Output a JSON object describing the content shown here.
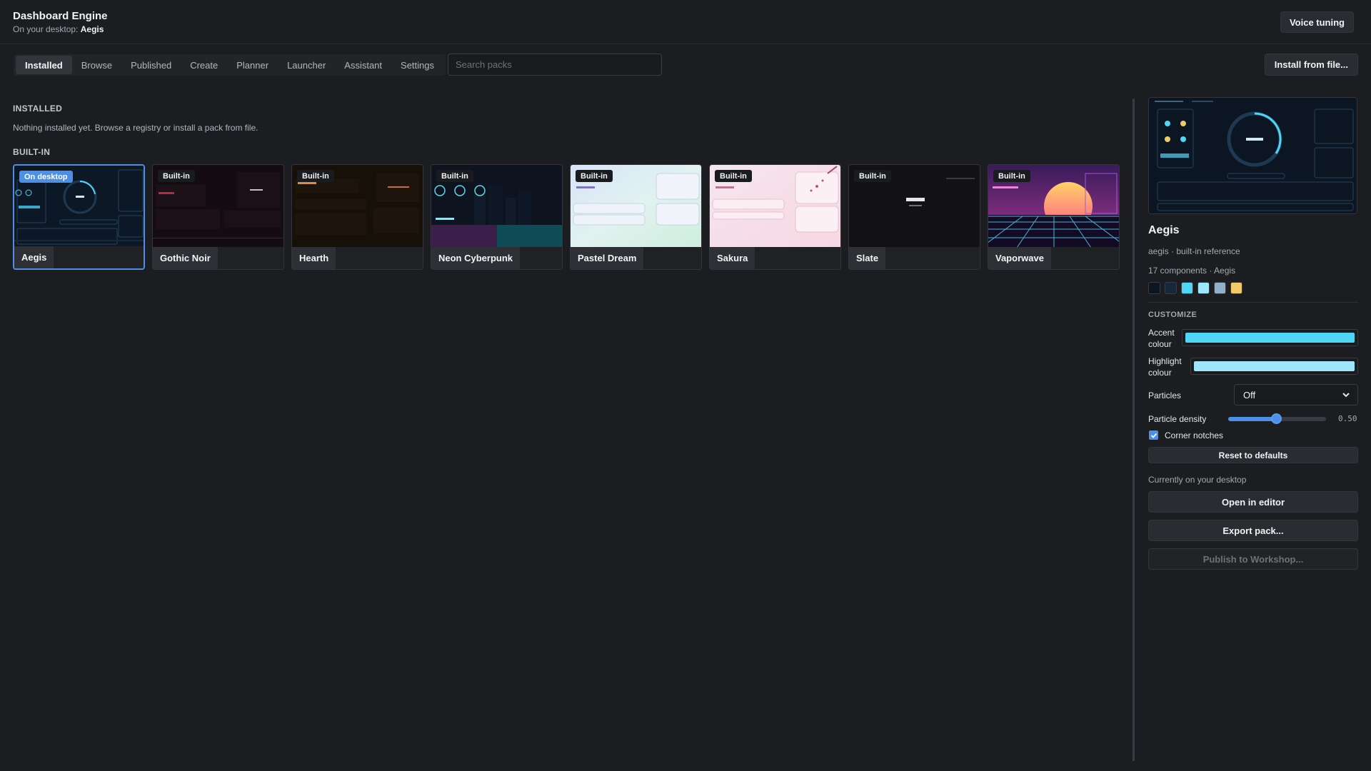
{
  "header": {
    "title": "Dashboard Engine",
    "subtitle_prefix": "On your desktop:",
    "subtitle_value": "Aegis",
    "voice_button": "Voice tuning"
  },
  "tabs": [
    {
      "label": "Installed",
      "active": true
    },
    {
      "label": "Browse"
    },
    {
      "label": "Published"
    },
    {
      "label": "Create"
    },
    {
      "label": "Planner"
    },
    {
      "label": "Launcher"
    },
    {
      "label": "Assistant"
    },
    {
      "label": "Settings"
    }
  ],
  "search": {
    "placeholder": "Search packs",
    "value": ""
  },
  "install_button": "Install from file...",
  "installed": {
    "title": "INSTALLED",
    "empty_note": "Nothing installed yet. Browse a registry or install a pack from file."
  },
  "builtin": {
    "title": "BUILT-IN",
    "cards": [
      {
        "name": "Aegis",
        "badge": "On desktop",
        "selected": true
      },
      {
        "name": "Gothic Noir",
        "badge": "Built-in"
      },
      {
        "name": "Hearth",
        "badge": "Built-in"
      },
      {
        "name": "Neon Cyberpunk",
        "badge": "Built-in"
      },
      {
        "name": "Pastel Dream",
        "badge": "Built-in"
      },
      {
        "name": "Sakura",
        "badge": "Built-in"
      },
      {
        "name": "Slate",
        "badge": "Built-in"
      },
      {
        "name": "Vaporwave",
        "badge": "Built-in"
      }
    ]
  },
  "detail": {
    "name": "Aegis",
    "meta": "aegis · built-in reference",
    "meta2": "17 components · Aegis",
    "swatches": [
      "#0b1622",
      "#16283a",
      "#4fd6f6",
      "#9de6fb",
      "#8fb0c8",
      "#f0c96a"
    ],
    "customize_title": "CUSTOMIZE",
    "accent_label": "Accent colour",
    "accent_color": "#4fd6f6",
    "highlight_label": "Highlight colour",
    "highlight_color": "#9de6fb",
    "particles_label": "Particles",
    "particles_value": "Off",
    "density_label": "Particle density",
    "density_value": "0.50",
    "corner_label": "Corner notches",
    "corner_checked": true,
    "reset_button": "Reset to defaults",
    "desktop_note": "Currently on your desktop",
    "open_button": "Open in editor",
    "export_button": "Export pack...",
    "publish_button": "Publish to Workshop..."
  }
}
